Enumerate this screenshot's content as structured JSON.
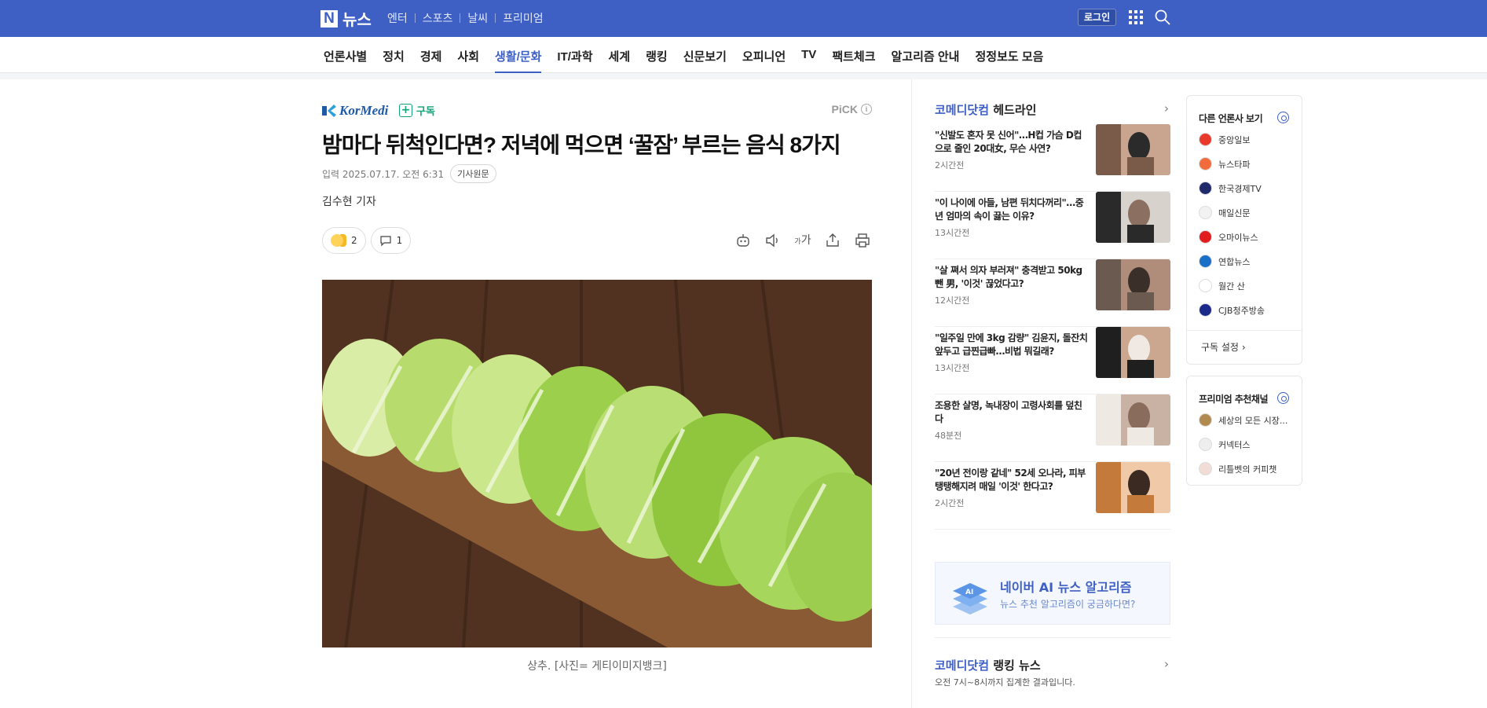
{
  "header": {
    "logo_letter": "N",
    "logo_text": "뉴스",
    "service_nav": [
      "엔터",
      "스포츠",
      "날씨",
      "프리미엄"
    ],
    "login_label": "로그인",
    "brand_color": "#3e5fc4"
  },
  "categories": {
    "items": [
      "언론사별",
      "정치",
      "경제",
      "사회",
      "생활/문화",
      "IT/과학",
      "세계",
      "랭킹",
      "신문보기",
      "오피니언",
      "TV",
      "팩트체크",
      "알고리즘 안내",
      "정정보도 모음"
    ],
    "active": "생활/문화"
  },
  "article": {
    "press_name": "KorMedi",
    "subscribe_label": "구독",
    "pick_label": "PiCK",
    "headline": "밤마다 뒤척인다면? 저녁에 먹으면 ‘꿀잠’ 부르는 음식 8가지",
    "date": "입력 2025.07.17. 오전 6:31",
    "original_label": "기사원문",
    "byline": "김수현 기자",
    "reaction_count": "2",
    "comment_count": "1",
    "font_size_label": "가",
    "photo_caption": "상추. [사진= 게티이미지뱅크]"
  },
  "headlines": {
    "brand": "코메디닷컴",
    "title_suffix": " 헤드라인",
    "items": [
      {
        "title": "\"신발도 혼자 못 신어\"…H컵 가슴 D컵으로 줄인 20대女, 무슨 사연?",
        "time": "2시간전"
      },
      {
        "title": "\"이 나이에 아들, 남편 뒤치다꺼리\"…중년 엄마의 속이 끓는 이유?",
        "time": "13시간전"
      },
      {
        "title": "\"살 쪄서 의자 부러져\" 충격받고 50kg 뺀 男, '이것' 끊었다고?",
        "time": "12시간전"
      },
      {
        "title": "\"일주일 만에 3kg 감량\" 김윤지, 돌잔치 앞두고 급찐급빠…비법 뭐길래?",
        "time": "13시간전"
      },
      {
        "title": "조용한 살명, 녹내장이 고령사회를 덮친다",
        "time": "48분전"
      },
      {
        "title": "\"20년 전이랑 같네\" 52세 오나라, 피부 탱탱해지려 매일 '이것' 한다고?",
        "time": "2시간전"
      }
    ],
    "ai_banner_title": "네이버 AI 뉴스 알고리즘",
    "ai_banner_sub": "뉴스 추천 알고리즘이 궁금하다면?",
    "ranking_brand": "코메디닷컴",
    "ranking_suffix": " 랭킹 뉴스",
    "ranking_sub": "오전 7시~8시까지 집계한 결과입니다."
  },
  "side": {
    "press_title": "다른 언론사 보기",
    "press_list": [
      {
        "name": "중앙일보",
        "color": "#e8392b"
      },
      {
        "name": "뉴스타파",
        "color": "#f26b3a"
      },
      {
        "name": "한국경제TV",
        "color": "#1f2a6b"
      },
      {
        "name": "매일신문",
        "color": "#f2f2f2"
      },
      {
        "name": "오마이뉴스",
        "color": "#e21d1d"
      },
      {
        "name": "연합뉴스",
        "color": "#1a6fc7"
      },
      {
        "name": "월간 산",
        "color": "#ffffff"
      },
      {
        "name": "CJB청주방송",
        "color": "#1b2a8a"
      }
    ],
    "subscribe_setting": "구독 설정",
    "premium_title": "프리미엄 추천채널",
    "premium_list": [
      {
        "name": "세상의 모든 시장...",
        "color": "#b08a4e"
      },
      {
        "name": "커넥터스",
        "color": "#eeeeee"
      },
      {
        "name": "리틀벳의 커피챗",
        "color": "#f1ddd6"
      }
    ]
  }
}
